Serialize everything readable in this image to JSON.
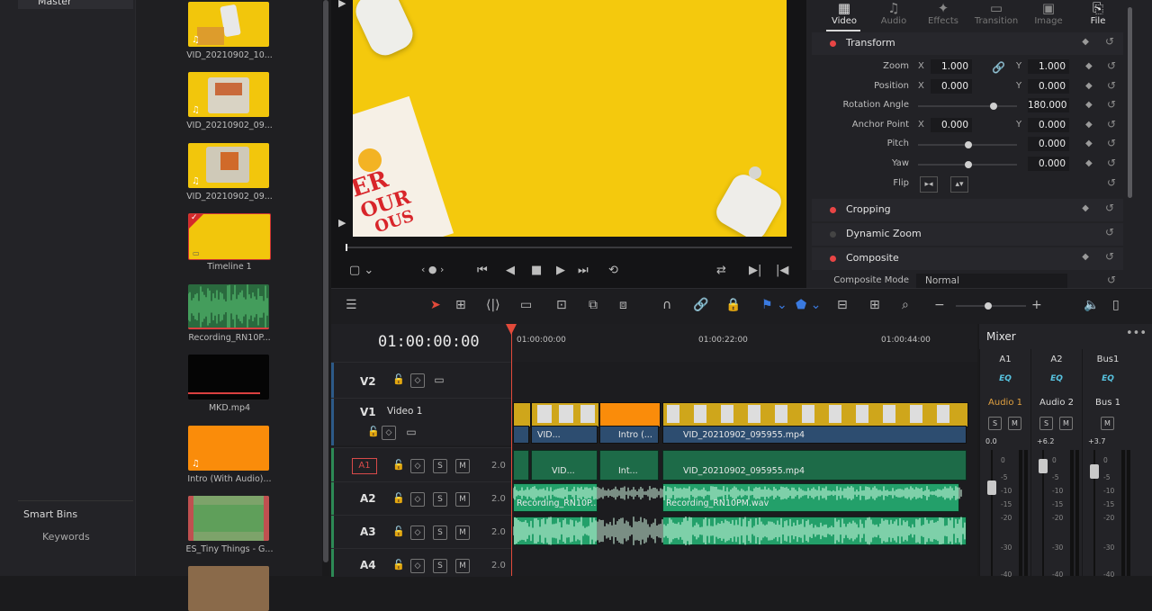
{
  "bins": {
    "master": "Master",
    "smart_bins": "Smart Bins",
    "keywords": "Keywords"
  },
  "media_pool": [
    {
      "label": "VID_20210902_10..."
    },
    {
      "label": "VID_20210902_09..."
    },
    {
      "label": "VID_20210902_09..."
    },
    {
      "label": "Timeline 1"
    },
    {
      "label": "Recording_RN10P..."
    },
    {
      "label": "MKD.mp4"
    },
    {
      "label": "Intro (With Audio)..."
    },
    {
      "label": "ES_Tiny Things - G..."
    }
  ],
  "viewer": {
    "book_text_1": "ER",
    "book_text_2": "OUR",
    "book_text_3": "OUS"
  },
  "inspector": {
    "tabs": [
      {
        "label": "Video",
        "icon": "film-icon"
      },
      {
        "label": "Audio",
        "icon": "music-note-icon"
      },
      {
        "label": "Effects",
        "icon": "wand-icon"
      },
      {
        "label": "Transition",
        "icon": "transition-icon"
      },
      {
        "label": "Image",
        "icon": "image-icon"
      },
      {
        "label": "File",
        "icon": "file-icon"
      }
    ],
    "sections": {
      "transform": "Transform",
      "cropping": "Cropping",
      "dynamic_zoom": "Dynamic Zoom",
      "composite": "Composite"
    },
    "params": {
      "zoom_label": "Zoom",
      "zoom_x": "1.000",
      "zoom_y": "1.000",
      "position_label": "Position",
      "position_x": "0.000",
      "position_y": "0.000",
      "rotation_label": "Rotation Angle",
      "rotation": "180.000",
      "anchor_label": "Anchor Point",
      "anchor_x": "0.000",
      "anchor_y": "0.000",
      "pitch_label": "Pitch",
      "pitch": "0.000",
      "yaw_label": "Yaw",
      "yaw": "0.000",
      "flip_label": "Flip",
      "composite_mode_label": "Composite Mode",
      "composite_mode": "Normal",
      "axis_x": "X",
      "axis_y": "Y"
    }
  },
  "timeline": {
    "timecode": "01:00:00:00",
    "ruler": [
      "01:00:00:00",
      "01:00:22:00",
      "01:00:44:00"
    ],
    "tracks": {
      "v2": "V2",
      "v1": "V1",
      "v1_name": "Video 1",
      "a1": "A1",
      "a2": "A2",
      "a3": "A3",
      "a4": "A4",
      "vol": "2.0",
      "solo": "S",
      "mute": "M"
    },
    "clips": {
      "v1_a": "VID...",
      "v1_intro": "Intro (...",
      "v1_main": "VID_20210902_095955.mp4",
      "a1_a": "VID...",
      "a1_intro": "Int...",
      "a1_main": "VID_20210902_095955.mp4",
      "a2_rec1": "Recording_RN10P...",
      "a2_rec2": "Recording_RN10PM.wav"
    }
  },
  "mixer": {
    "title": "Mixer",
    "more": "•••",
    "channels": [
      {
        "ch": "A1",
        "eq": "EQ",
        "track": "Audio 1",
        "db": "0.0",
        "color": "#e0a040"
      },
      {
        "ch": "A2",
        "eq": "EQ",
        "track": "Audio 2",
        "db": "+6.2",
        "color": "#dcdcdc"
      },
      {
        "ch": "Bus1",
        "eq": "EQ",
        "track": "Bus 1",
        "db": "+3.7",
        "color": "#dcdcdc"
      }
    ],
    "scale": [
      "0",
      "-5",
      "-10",
      "-15",
      "-20",
      "-30",
      "-40"
    ],
    "solo": "S",
    "mute": "M"
  }
}
